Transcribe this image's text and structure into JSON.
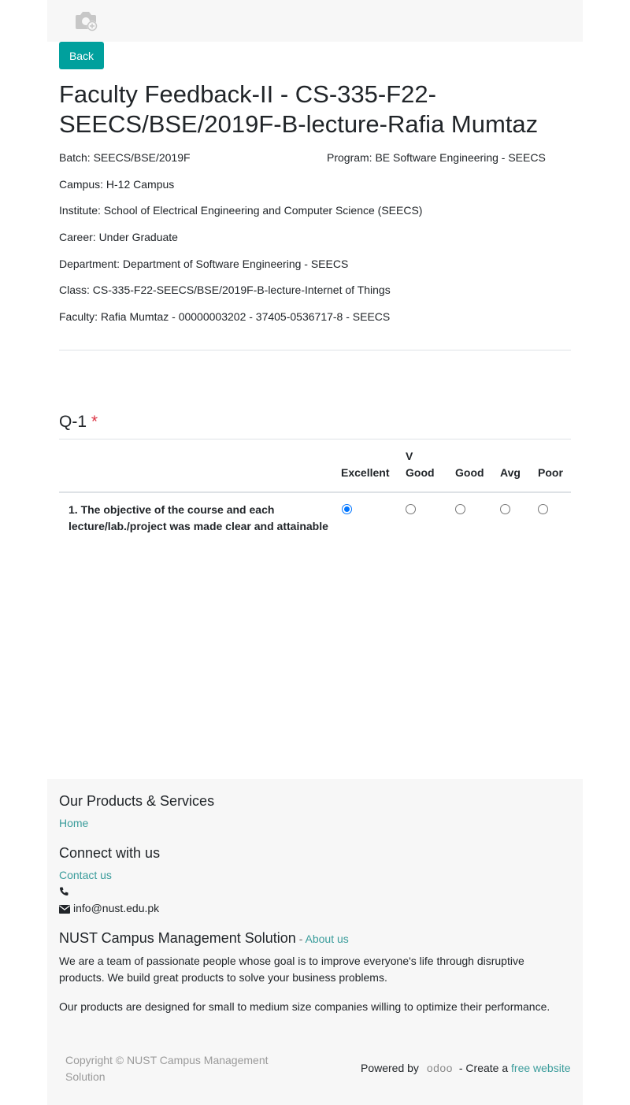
{
  "topbar": {
    "camera_icon": "camera-plus-icon"
  },
  "back_label": "Back",
  "title": "Faculty Feedback-II - CS-335-F22-SEECS/BSE/2019F-B-lecture-Rafia Mumtaz",
  "info": {
    "batch": "Batch: SEECS/BSE/2019F",
    "program": "Program: BE Software Engineering - SEECS",
    "campus": "Campus: H-12 Campus",
    "institute": "Institute: School of Electrical Engineering and Computer Science (SEECS)",
    "career": "Career: Under Graduate",
    "department": "Department: Department of Software Engineering - SEECS",
    "class": "Class: CS-335-F22-SEECS/BSE/2019F-B-lecture-Internet of Things",
    "faculty": "Faculty: Rafia Mumtaz - 00000003202 - 37405-0536717-8 - SEECS"
  },
  "question": {
    "label": "Q-1",
    "required_mark": "*",
    "columns": [
      "Excellent",
      "V",
      "Good",
      "Good",
      "Avg",
      "Poor"
    ],
    "rows": [
      {
        "text": "1. The objective of the course and each lecture/lab./project was made clear and attainable",
        "selected": "Excellent"
      }
    ]
  },
  "footer": {
    "products_heading": "Our Products & Services",
    "home_link": "Home",
    "connect_heading": "Connect with us",
    "contact_link": "Contact us",
    "phone_icon": "phone-icon",
    "mail_icon": "envelope-icon",
    "email": "info@nust.edu.pk",
    "company_heading": "NUST Campus Management Solution",
    "dash": " - ",
    "about_link": "About us",
    "para1": "We are a team of passionate people whose goal is to improve everyone's life through disruptive products. We build great products to solve your business problems.",
    "para2": "Our products are designed for small to medium size companies willing to optimize their performance.",
    "copyright": "Copyright © NUST Campus Management Solution",
    "powered_by": "Powered by",
    "odoo_logo": "odoo",
    "create_a": " - Create a ",
    "free_website": "free website"
  },
  "colors": {
    "accent": "#00a09d",
    "link": "#3a9c9b",
    "required": "#dc3545",
    "radio_selected": "#0075ff"
  }
}
